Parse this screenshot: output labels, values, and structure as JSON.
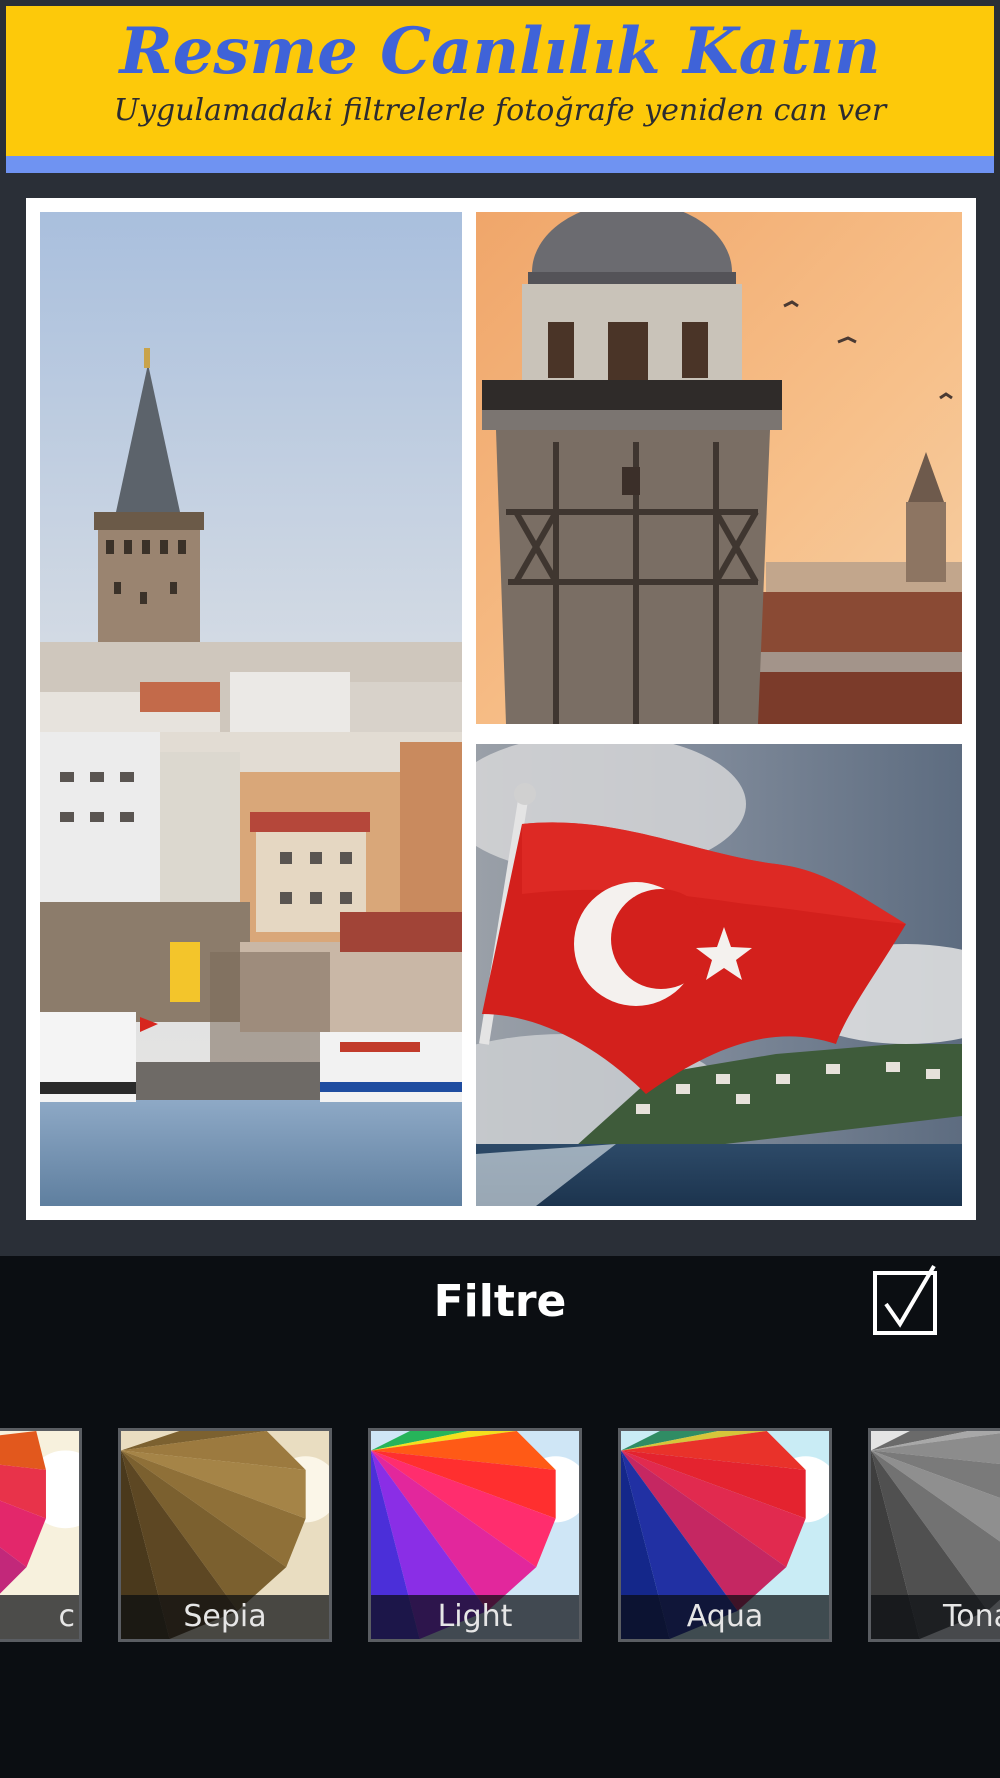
{
  "banner": {
    "title": "Resme Canlılık Katın",
    "subtitle": "Uygulamadaki filtrelerle fotoğrafe yeniden can ver",
    "bg_color": "#fdc90a",
    "stripe_color": "#6f93f2",
    "title_color": "#3f63d8"
  },
  "collage": {
    "photos": [
      {
        "subject": "galata-tower-cityscape"
      },
      {
        "subject": "tower-sunset"
      },
      {
        "subject": "turkish-flag"
      }
    ]
  },
  "filter_panel": {
    "title": "Filtre",
    "confirm_icon": "checkbox-check-icon",
    "filters": [
      {
        "label": "c"
      },
      {
        "label": "Sepia"
      },
      {
        "label": "Light"
      },
      {
        "label": "Aqua"
      },
      {
        "label": "Tona"
      }
    ]
  }
}
